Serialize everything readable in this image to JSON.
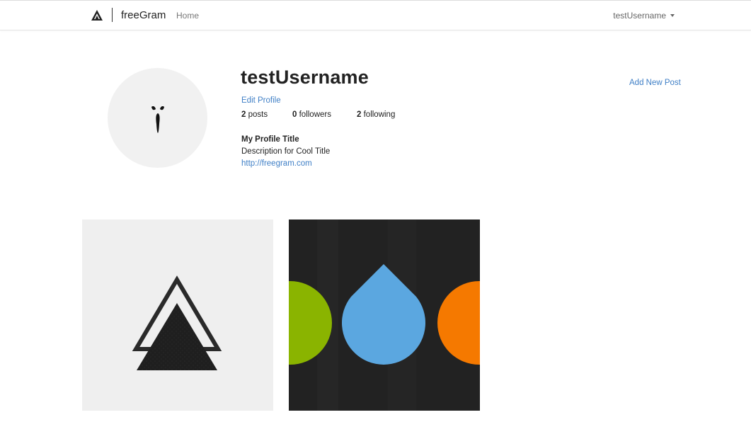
{
  "navbar": {
    "brand_name": "freeGram",
    "home_label": "Home",
    "user_menu_label": "testUsername",
    "logo_icon": "triangle-logo-icon"
  },
  "profile": {
    "username": "testUsername",
    "edit_profile_label": "Edit Profile",
    "add_post_label": "Add New Post",
    "stats": {
      "posts_count": "2",
      "posts_label": " posts",
      "followers_count": "0",
      "followers_label": " followers",
      "following_count": "2",
      "following_label": " following"
    },
    "title": "My Profile Title",
    "description": "Description for Cool Title",
    "url": "http://freegram.com",
    "avatar_icon": "ghostface-mask-icon"
  },
  "posts": [
    {
      "image_icon": "double-triangle-image",
      "background": "#efefef"
    },
    {
      "image_icon": "colored-drops-image",
      "background": "#222222",
      "colors": [
        "#8ab400",
        "#5ba7e0",
        "#f57900"
      ]
    }
  ],
  "colors": {
    "link": "#3f7fc6",
    "text": "#222222",
    "muted": "#777777"
  }
}
